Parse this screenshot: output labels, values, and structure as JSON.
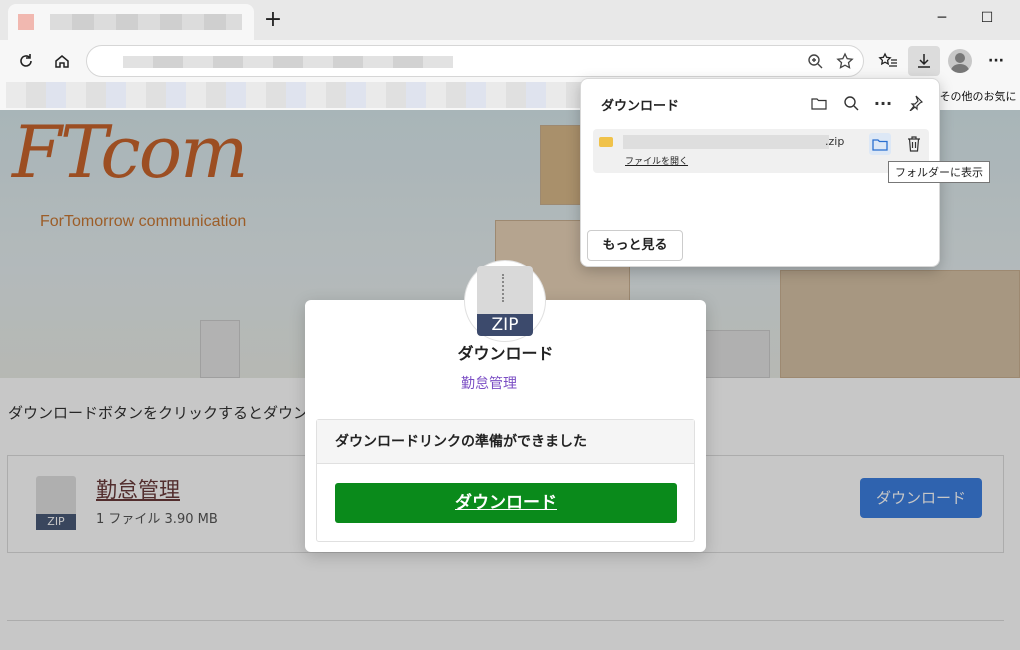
{
  "browser": {
    "new_tab": "+",
    "minimize": "─",
    "maximize": "☐",
    "more_menu": "···",
    "favorites_other": "その他のお気に"
  },
  "page": {
    "logo": "FTcom",
    "logo_sub": "ForTomorrow communication",
    "intro_text": "ダウンロードボタンをクリックするとダウン",
    "file": {
      "icon_label": "ZIP",
      "name": "勤怠管理",
      "meta": "1 ファイル   3.90 MB",
      "download_label": "ダウンロード"
    }
  },
  "modal": {
    "icon_label": "ZIP",
    "title": "ダウンロード",
    "subtitle": "勤怠管理",
    "box_header": "ダウンロードリンクの準備ができました",
    "button_label": "ダウンロード"
  },
  "downloads_panel": {
    "title": "ダウンロード",
    "item_ext": ".zip",
    "open_file": "ファイルを開く",
    "tooltip": "フォルダーに表示",
    "more": "もっと見る"
  },
  "colors": {
    "accent_green": "#0a8a1b",
    "accent_purple": "#7b4ec4",
    "card_button_blue": "#3d7fe0"
  }
}
